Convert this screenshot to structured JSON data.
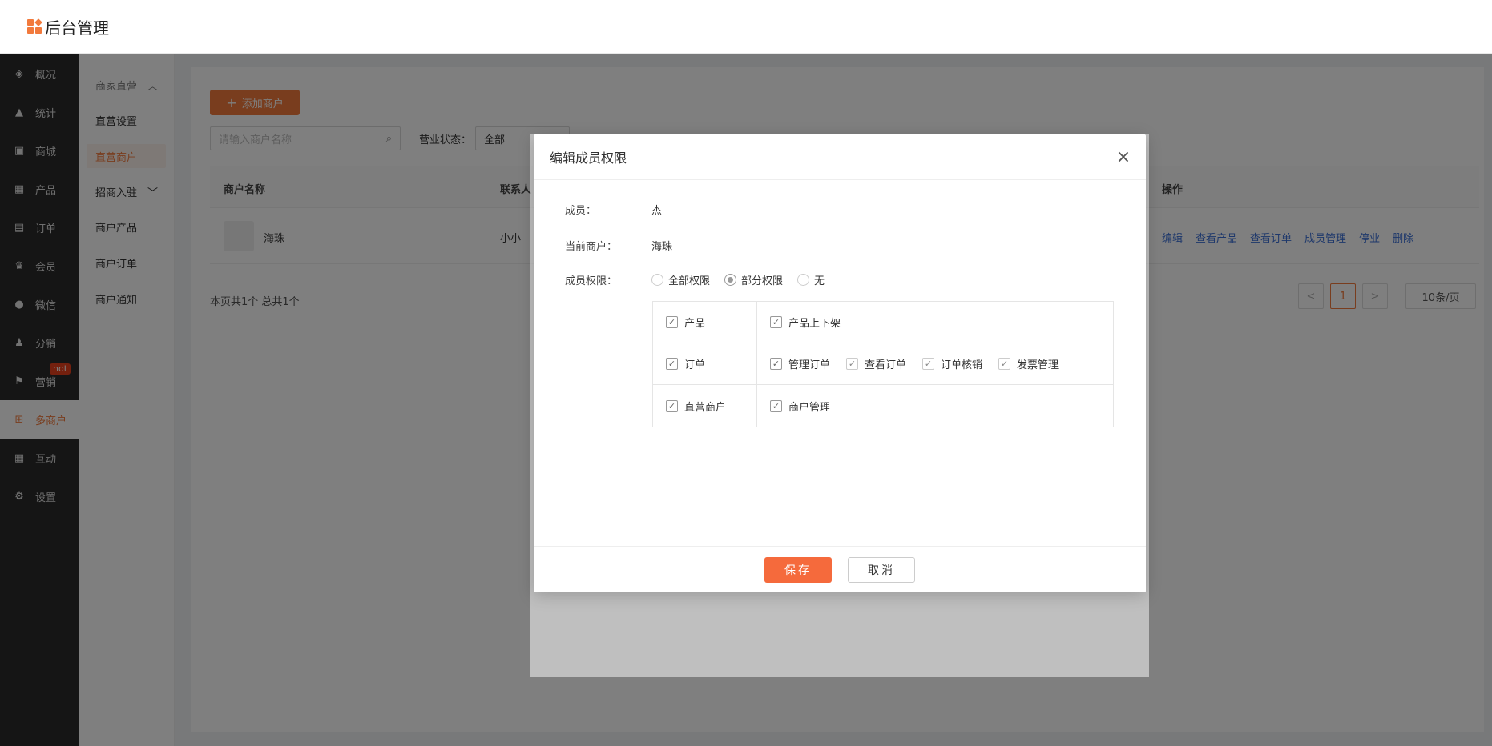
{
  "app": {
    "title": "后台管理"
  },
  "sidebar": {
    "items": [
      {
        "label": "概况",
        "icon": "layers-icon",
        "glyph": "◈"
      },
      {
        "label": "统计",
        "icon": "chart-icon",
        "glyph": "▲"
      },
      {
        "label": "商城",
        "icon": "shop-icon",
        "glyph": "▣"
      },
      {
        "label": "产品",
        "icon": "grid-icon",
        "glyph": "▦"
      },
      {
        "label": "订单",
        "icon": "clipboard-icon",
        "glyph": "▤"
      },
      {
        "label": "会员",
        "icon": "crown-icon",
        "glyph": "♛"
      },
      {
        "label": "微信",
        "icon": "wechat-icon",
        "glyph": "●"
      },
      {
        "label": "分销",
        "icon": "user-icon",
        "glyph": "♟"
      },
      {
        "label": "营销",
        "icon": "flag-icon",
        "glyph": "⚑",
        "badge": "hot"
      },
      {
        "label": "多商户",
        "icon": "merchant-icon",
        "glyph": "⊞",
        "active": true
      },
      {
        "label": "互动",
        "icon": "apps-icon",
        "glyph": "▦"
      },
      {
        "label": "设置",
        "icon": "gear-icon",
        "glyph": "⚙"
      }
    ]
  },
  "subnav": {
    "group1": "商家直营",
    "item1": "直营设置",
    "item2": "直营商户",
    "group2": "招商入驻",
    "item3": "商户产品",
    "item4": "商户订单",
    "item5": "商户通知"
  },
  "toolbar": {
    "add_label": "添加商户",
    "search_placeholder": "请输入商户名称",
    "status_label": "营业状态：",
    "status_value": "全部"
  },
  "table": {
    "headers": {
      "name": "商户名称",
      "contact": "联系人",
      "ops": "操作"
    },
    "rows": [
      {
        "name": "海珠",
        "contact": "小小",
        "ops": [
          "编辑",
          "查看产品",
          "查看订单",
          "成员管理",
          "停业",
          "删除"
        ]
      }
    ],
    "summary": "本页共1个 总共1个",
    "pager": {
      "prev": "<",
      "current": "1",
      "next": ">",
      "size": "10条/页"
    }
  },
  "dialog": {
    "title": "编辑成员权限",
    "member_label": "成员：",
    "member_value": "杰",
    "merchant_label": "当前商户：",
    "merchant_value": "海珠",
    "perm_label": "成员权限：",
    "perm_options": [
      "全部权限",
      "部分权限",
      "无"
    ],
    "perm_selected": "部分权限",
    "perm_rows": [
      {
        "group": "产品",
        "items": [
          "产品上下架"
        ]
      },
      {
        "group": "订单",
        "items": [
          "管理订单",
          "查看订单",
          "订单核销",
          "发票管理"
        ]
      },
      {
        "group": "直营商户",
        "items": [
          "商户管理"
        ]
      }
    ],
    "save_label": "保存",
    "cancel_label": "取消"
  },
  "colors": {
    "accent": "#f27a3c",
    "sidebar_bg": "#2b2b2b",
    "link": "#3a6fd6"
  }
}
